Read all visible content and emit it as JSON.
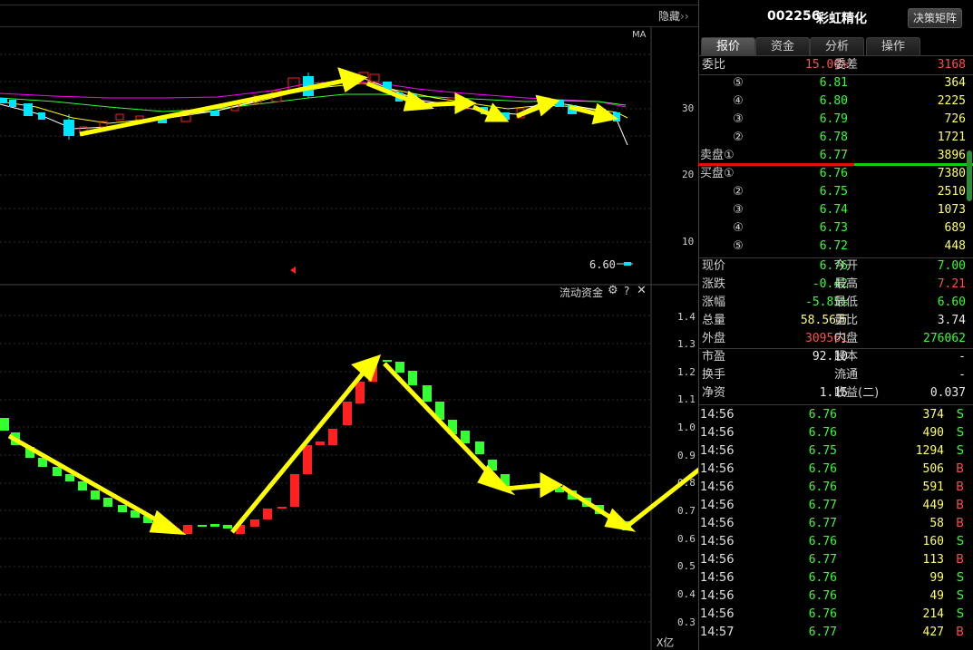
{
  "top_bar": {
    "hide_label": "隐藏",
    "hide_icon": "double-chevron-right-icon"
  },
  "main_chart": {
    "ma_label": "MA",
    "y_ticks": [
      "30",
      "20",
      "10"
    ],
    "low_marker": "6.60",
    "colors": {
      "up": "#ff2020",
      "down": "#00e5ff",
      "ma5": "#ffffff",
      "ma10": "#ffff00",
      "ma20": "#ff00ff",
      "ma30": "#33ff33"
    }
  },
  "flow_chart": {
    "title": "流动资金",
    "unit_label": "X亿",
    "y_ticks": [
      "1.4",
      "1.3",
      "1.2",
      "1.1",
      "1.0",
      "0.9",
      "0.8",
      "0.7",
      "0.6",
      "0.5",
      "0.4",
      "0.3"
    ],
    "icons": [
      "gear-icon",
      "help-icon",
      "close-icon"
    ]
  },
  "header": {
    "code": "002256",
    "name": "彩虹精化",
    "decision_button": "决策矩阵"
  },
  "tabs": [
    {
      "label": "报价",
      "active": true
    },
    {
      "label": "资金",
      "active": false
    },
    {
      "label": "分析",
      "active": false
    },
    {
      "label": "操作",
      "active": false
    }
  ],
  "weibi": {
    "label": "委比",
    "value": "15.06%",
    "label2": "委差",
    "value2": "3168"
  },
  "sell_orders": [
    {
      "level": "⑤",
      "price": "6.81",
      "volume": "364"
    },
    {
      "level": "④",
      "price": "6.80",
      "volume": "2225"
    },
    {
      "level": "③",
      "price": "6.79",
      "volume": "726"
    },
    {
      "level": "②",
      "price": "6.78",
      "volume": "1721"
    },
    {
      "level": "卖盘①",
      "price": "6.77",
      "volume": "3896"
    }
  ],
  "buy_orders": [
    {
      "level": "买盘①",
      "price": "6.76",
      "volume": "7380"
    },
    {
      "level": "②",
      "price": "6.75",
      "volume": "2510"
    },
    {
      "level": "③",
      "price": "6.74",
      "volume": "1073"
    },
    {
      "level": "④",
      "price": "6.73",
      "volume": "689"
    },
    {
      "level": "⑤",
      "price": "6.72",
      "volume": "448"
    }
  ],
  "stats1": [
    {
      "l1": "现价",
      "v1": "6.76",
      "c1": "g",
      "l2": "今开",
      "v2": "7.00",
      "c2": "g"
    },
    {
      "l1": "涨跌",
      "v1": "-0.42",
      "c1": "g",
      "l2": "最高",
      "v2": "7.21",
      "c2": "r"
    },
    {
      "l1": "涨幅",
      "v1": "-5.85%",
      "c1": "g",
      "l2": "最低",
      "v2": "6.60",
      "c2": "g"
    },
    {
      "l1": "总量",
      "v1": "58.56万",
      "c1": "y",
      "l2": "量比",
      "v2": "3.74",
      "c2": "w"
    },
    {
      "l1": "外盘",
      "v1": "309561",
      "c1": "r",
      "l2": "内盘",
      "v2": "276062",
      "c2": "g"
    }
  ],
  "stats2": [
    {
      "l1": "市盈",
      "v1": "92.10",
      "l2": "股本",
      "v2": "-"
    },
    {
      "l1": "换手",
      "v1": "-",
      "l2": "流通",
      "v2": "-"
    },
    {
      "l1": "净资",
      "v1": "1.15",
      "l2": "收益(二)",
      "v2": "0.037"
    }
  ],
  "ticks": [
    {
      "time": "14:56",
      "price": "6.76",
      "vol": "374",
      "side": "S"
    },
    {
      "time": "14:56",
      "price": "6.76",
      "vol": "490",
      "side": "S"
    },
    {
      "time": "14:56",
      "price": "6.75",
      "vol": "1294",
      "side": "S"
    },
    {
      "time": "14:56",
      "price": "6.76",
      "vol": "506",
      "side": "B"
    },
    {
      "time": "14:56",
      "price": "6.76",
      "vol": "591",
      "side": "B"
    },
    {
      "time": "14:56",
      "price": "6.77",
      "vol": "449",
      "side": "B"
    },
    {
      "time": "14:56",
      "price": "6.77",
      "vol": "58",
      "side": "B"
    },
    {
      "time": "14:56",
      "price": "6.76",
      "vol": "160",
      "side": "S"
    },
    {
      "time": "14:56",
      "price": "6.77",
      "vol": "113",
      "side": "B"
    },
    {
      "time": "14:56",
      "price": "6.76",
      "vol": "99",
      "side": "S"
    },
    {
      "time": "14:56",
      "price": "6.76",
      "vol": "49",
      "side": "S"
    },
    {
      "time": "14:56",
      "price": "6.76",
      "vol": "214",
      "side": "S"
    },
    {
      "time": "14:57",
      "price": "6.77",
      "vol": "427",
      "side": "B"
    }
  ]
}
